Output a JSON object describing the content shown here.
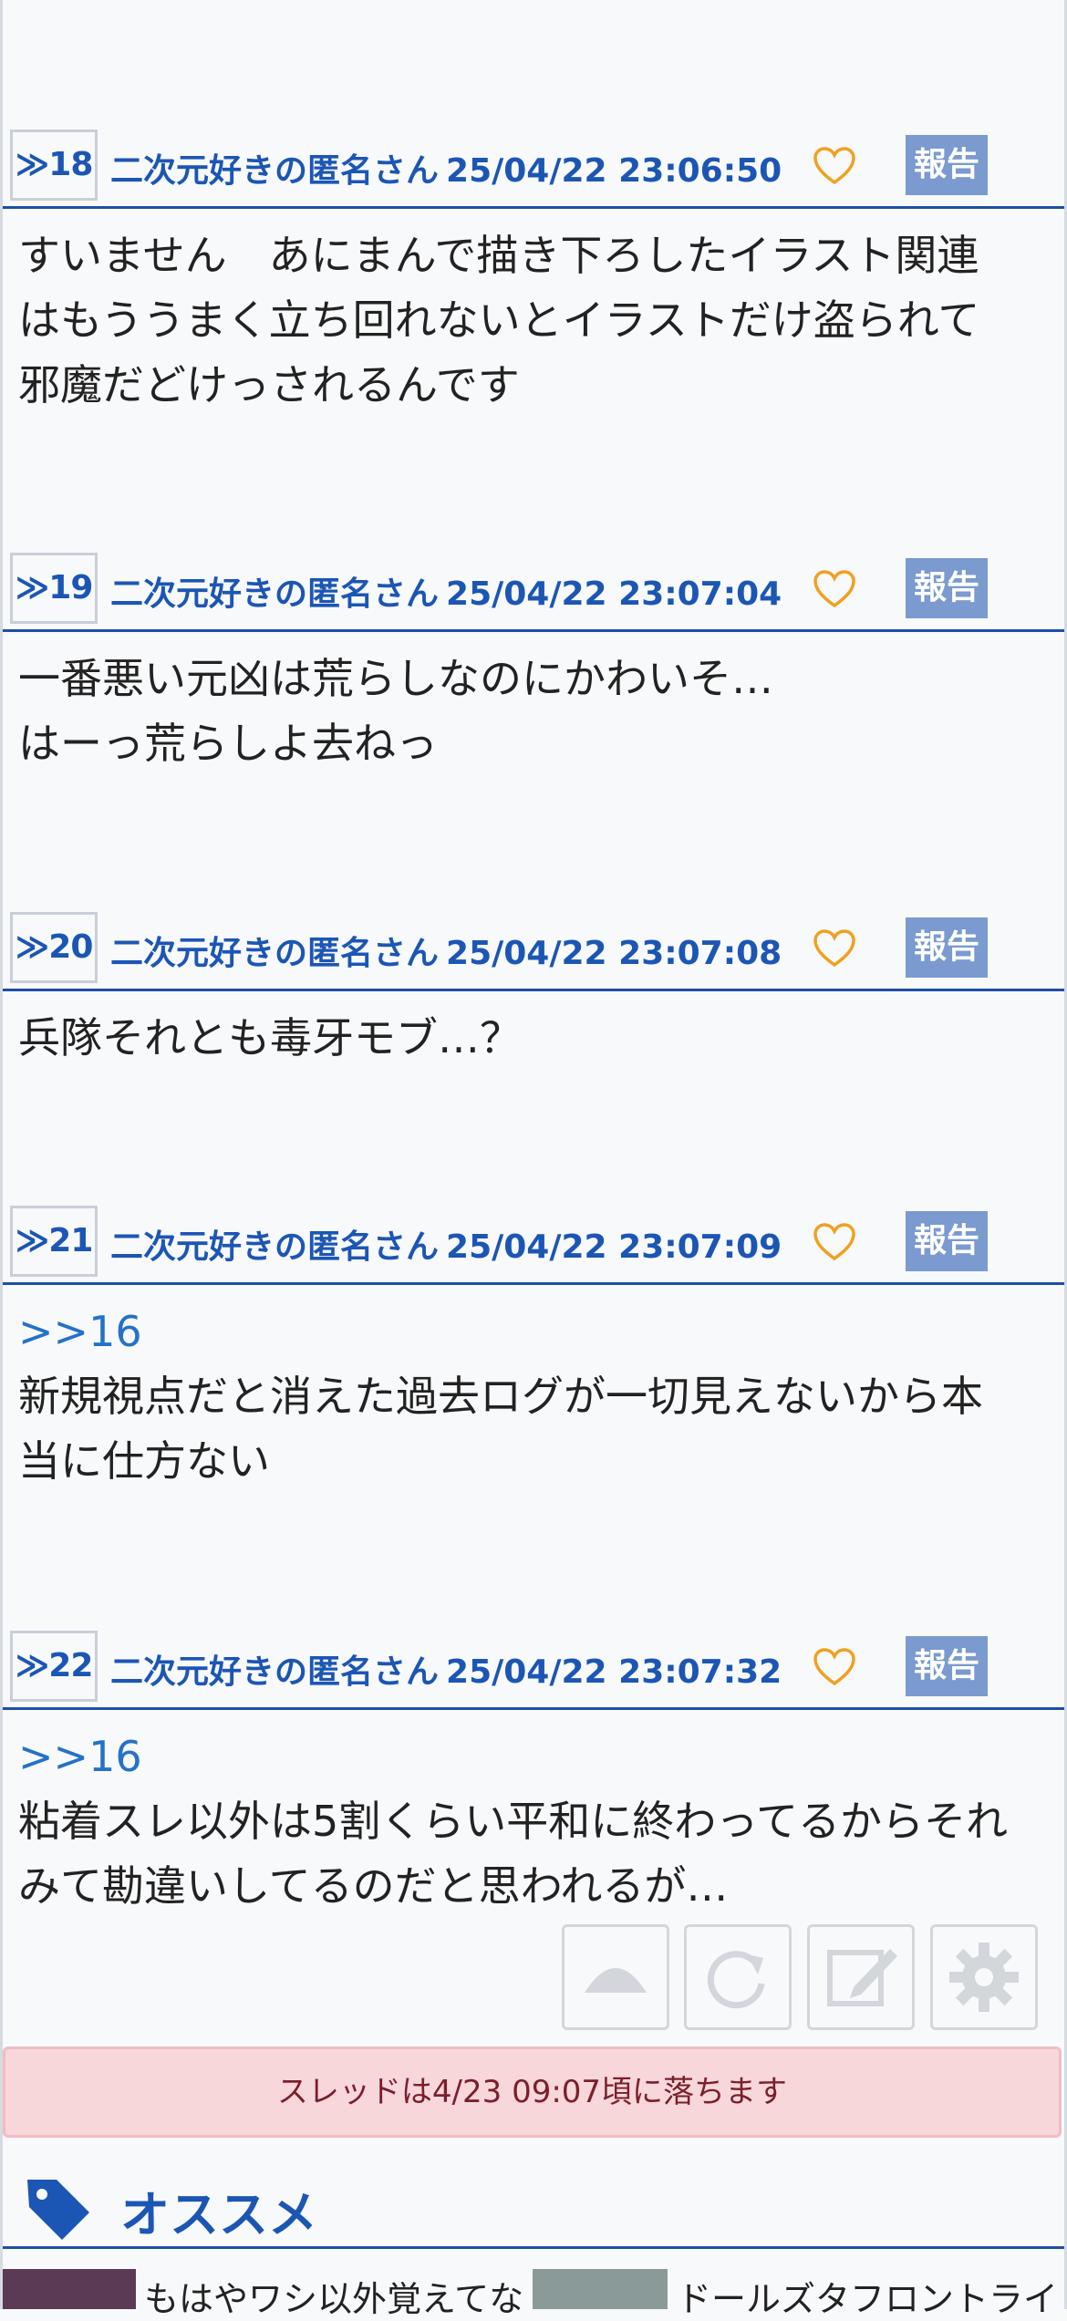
{
  "posts": [
    {
      "number": "≫18",
      "author": "二次元好きの匿名さん",
      "datetime": "25/04/22 23:06:50",
      "report_label": "報告",
      "anchor": "",
      "body": "すいません　あにまんで描き下ろしたイラスト関連\nはもううまく立ち回れないとイラストだけ盗られて\n邪魔だどけっされるんです"
    },
    {
      "number": "≫19",
      "author": "二次元好きの匿名さん",
      "datetime": "25/04/22 23:07:04",
      "report_label": "報告",
      "anchor": "",
      "body": "一番悪い元凶は荒らしなのにかわいそ…\nはーっ荒らしよ去ねっ"
    },
    {
      "number": "≫20",
      "author": "二次元好きの匿名さん",
      "datetime": "25/04/22 23:07:08",
      "report_label": "報告",
      "anchor": "",
      "body": "兵隊それとも毒牙モブ…？"
    },
    {
      "number": "≫21",
      "author": "二次元好きの匿名さん",
      "datetime": "25/04/22 23:07:09",
      "report_label": "報告",
      "anchor": ">>16",
      "body": "新規視点だと消えた過去ログが一切見えないから本\n当に仕方ない"
    },
    {
      "number": "≫22",
      "author": "二次元好きの匿名さん",
      "datetime": "25/04/22 23:07:32",
      "report_label": "報告",
      "anchor": ">>16",
      "body": "粘着スレ以外は5割くらい平和に終わってるからそれ\nみて勘違いしてるのだと思われるが…"
    }
  ],
  "floating_buttons": [
    "scroll-top-icon",
    "reload-icon",
    "compose-icon",
    "gear-icon"
  ],
  "notice": "スレッドは4/23 09:07頃に落ちます",
  "recommend": {
    "title": "オススメ",
    "items": [
      "もはやワシ以外覚えてな",
      "ドールズタフロントライ"
    ]
  },
  "colors": {
    "link_blue": "#1c56b4",
    "anchor_blue": "#2472c8",
    "report_bg": "#7a9ad0",
    "heart": "#f0a020",
    "notice_bg": "#f7d7da"
  }
}
